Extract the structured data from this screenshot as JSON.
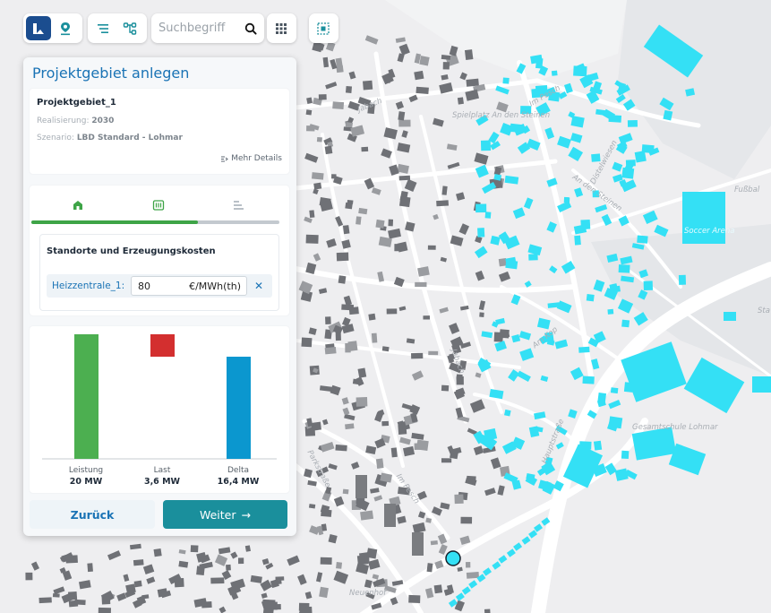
{
  "toolbar": {
    "search_placeholder": "Suchbegriff"
  },
  "panel": {
    "title": "Projektgebiet anlegen",
    "project": {
      "name": "Projektgebiet_1",
      "realisierung_label": "Realisierung:",
      "realisierung_value": "2030",
      "szenario_label": "Szenario:",
      "szenario_value": "LBD Standard - Lohmar",
      "more_details": "Mehr Details"
    },
    "steps": {
      "progress": 0.67
    },
    "costs": {
      "title": "Standorte und Erzeugungskosten",
      "row_label": "Heizzentrale_1:",
      "value": "80",
      "unit": "€/MWh(th)"
    },
    "buttons": {
      "back": "Zurück",
      "next": "Weiter"
    }
  },
  "chart_data": {
    "type": "bar",
    "categories": [
      "Leistung",
      "Last",
      "Delta"
    ],
    "values": [
      20,
      3.6,
      16.4
    ],
    "value_labels": [
      "20 MW",
      "3,6 MW",
      "16,4 MW"
    ],
    "bar_style": "waterfall",
    "colors": [
      "#4caf50",
      "#d32f2f",
      "#0b97cf"
    ],
    "ylim": [
      0,
      20
    ]
  },
  "map": {
    "labels": {
      "jabach_north": "Jabach",
      "spielplatz": "Spielplatz An den Steinen",
      "im_pesch_north": "Im Pesch",
      "distelwiesen": "Distelwiesen",
      "an_den_steinen": "An den Steinen",
      "soccer": "Soccer Arena",
      "fussball": "Fußbal",
      "am_kop": "Am Kop",
      "jabach_south": "Jabach",
      "hauptstrasse": "Hauptstraße",
      "gesamtschule": "Gesamtschule Lohmar",
      "parkstrasse": "Parkstraße",
      "im_pesch_south": "Im Pesch",
      "neuenhof": "Neuenhof",
      "sta": "Sta"
    },
    "colors": {
      "highlight": "#34e0f5",
      "building": "#6f7176",
      "street": "#ffffff",
      "background": "#eeeef0"
    }
  }
}
